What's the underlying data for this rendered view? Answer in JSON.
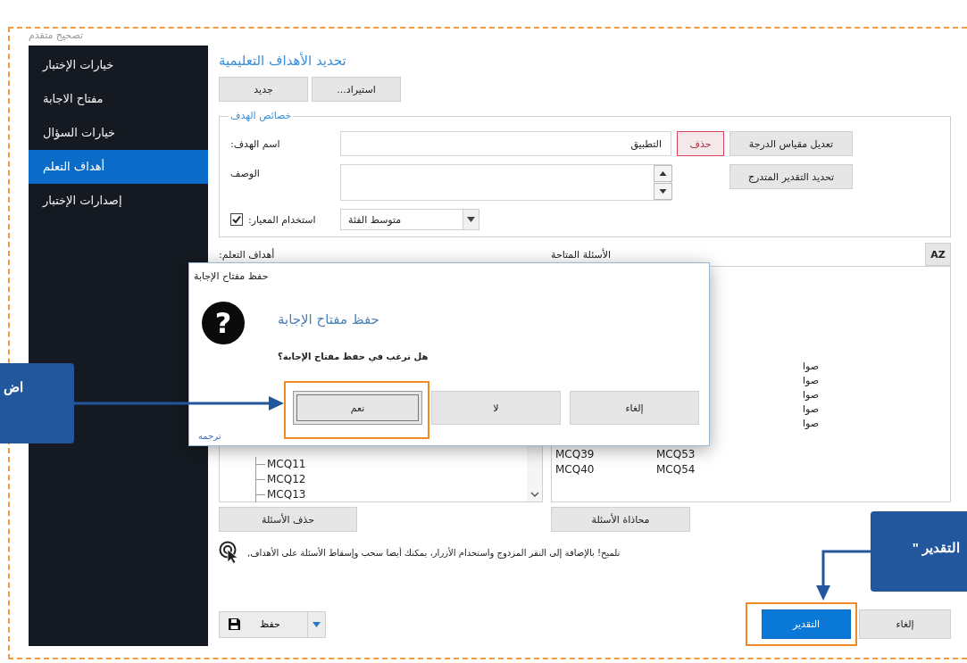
{
  "app_title": "تصحيح متقدم",
  "sidebar": {
    "items": [
      {
        "label": "خيارات الإختبار",
        "selected": false
      },
      {
        "label": "مفتاح الاجابة",
        "selected": false
      },
      {
        "label": "خيارات السؤال",
        "selected": false
      },
      {
        "label": "أهداف التعلم",
        "selected": true
      },
      {
        "label": "إصدارات الإختبار",
        "selected": false
      }
    ]
  },
  "main": {
    "heading": "تحديد الأهداف التعليمية",
    "toolbar": [
      "استيراد...",
      "جديد"
    ],
    "properties": {
      "legend": "خصائص الهدف",
      "name_label": "اسم الهدف:",
      "name_value": "التطبيق",
      "delete_button": "حذف",
      "edit_scale_button": "تعديل مقياس الدرجة",
      "description_label": "الوصف",
      "rubric_button": "تحديد التقدير المتدرج",
      "use_criterion": {
        "label": "استخدام المعيار:",
        "checked": true
      },
      "criterion_select": "متوسط الفئة"
    },
    "objectives": {
      "label": "أهداف التعلم:",
      "items": [
        "MCQ11",
        "MCQ12",
        "MCQ13"
      ],
      "remove_button": "حذف الأسئلة"
    },
    "available": {
      "label": "الأسئلة المتاحة",
      "sort_button": "AZ",
      "column_1": [
        "MCQ39",
        "MCQ40"
      ],
      "column_2": [
        "MCQ53",
        "MCQ54"
      ],
      "column_3": [
        "صوا",
        "صوا",
        "صوا",
        "صوا",
        "صوا"
      ],
      "align_button": "محاذاة الأسئلة"
    },
    "tip": "تلميح! بالإضافة إلى النقر المزدوج واستخدام الأزرار، يمكنك أيضا سحب وإسقاط الأسئلة على الأهداف,",
    "footer": {
      "save_button": "حفظ",
      "grade_button": "التقدير",
      "cancel_button": "إلغاء"
    }
  },
  "dialog": {
    "title": "حفظ مفتاح الإجابة",
    "icon": "?",
    "heading": "حفظ مفتاح الإجابة",
    "message": "هل ترغب في حفظ مفتاح الإجابة؟",
    "buttons": [
      {
        "label": "إلغاء",
        "default": false
      },
      {
        "label": "لا",
        "default": false
      },
      {
        "label": "نعم",
        "default": true
      }
    ],
    "link": "ترجمه"
  },
  "callouts": [
    {
      "text": "اض"
    },
    {
      "text": "التقدير \""
    }
  ]
}
